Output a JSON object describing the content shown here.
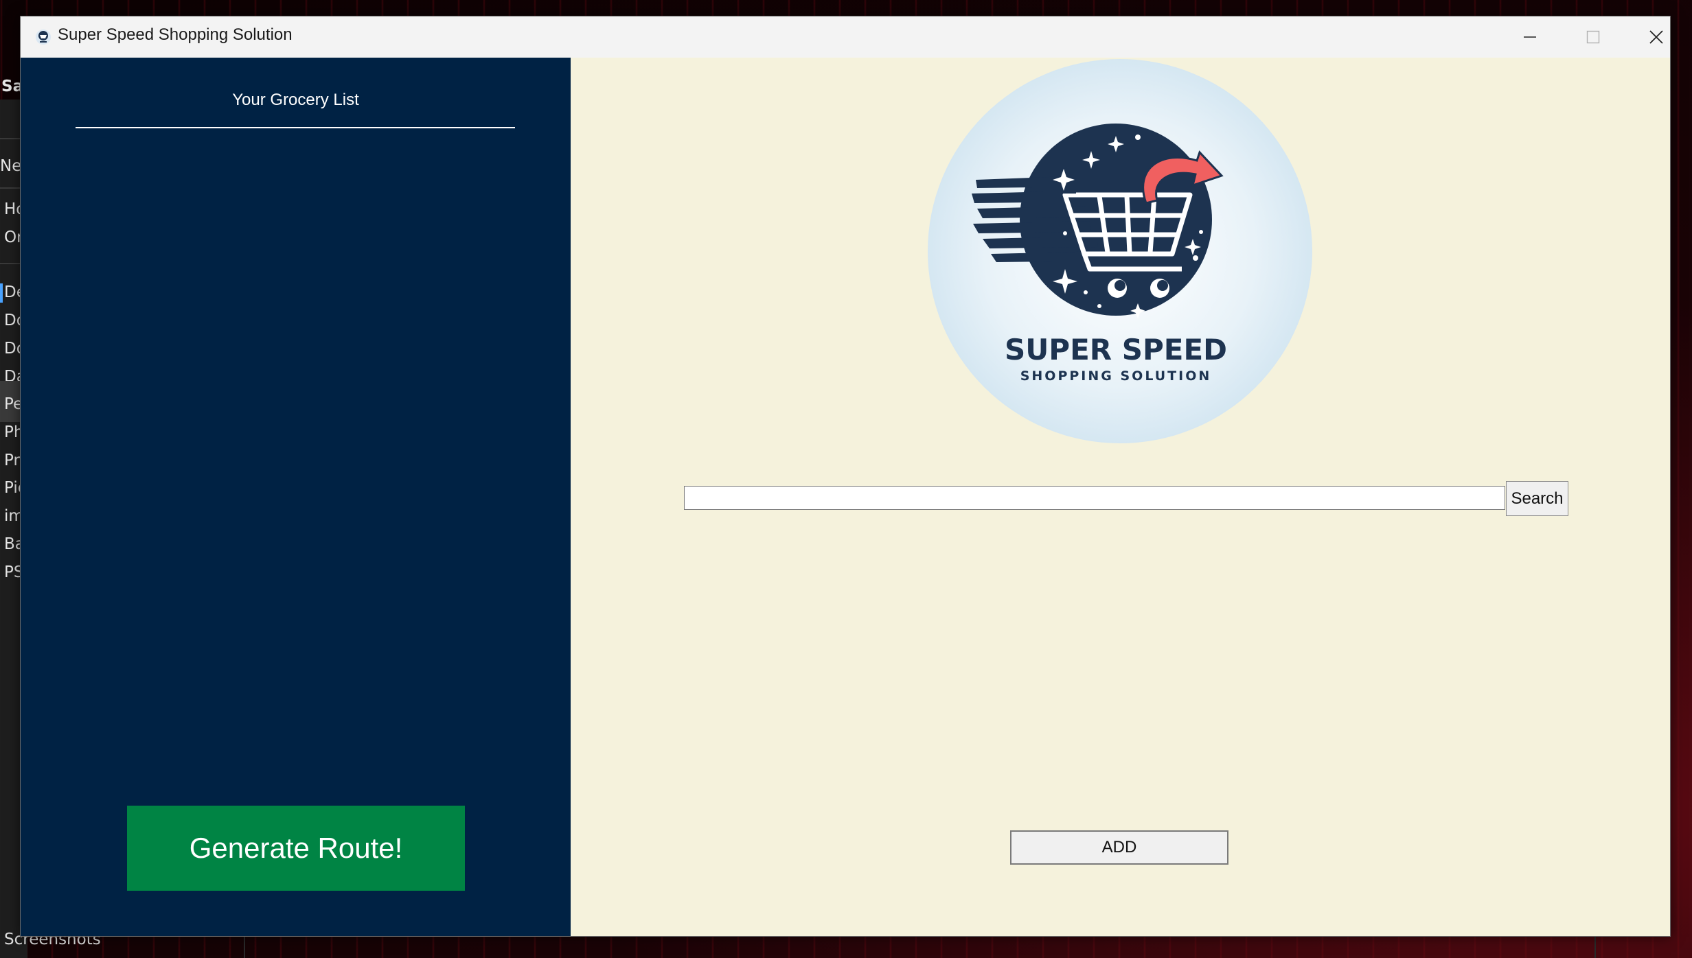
{
  "window": {
    "title": "Super Speed Shopping Solution",
    "controls": [
      "minimize",
      "maximize",
      "close"
    ]
  },
  "background_explorer": {
    "items": [
      "Sa",
      "Nev",
      "Ho",
      "On",
      "De",
      "Do",
      "Do",
      "Da",
      "Pe",
      "Ph",
      "Pr",
      "Pic",
      "im",
      "Ba",
      "PS"
    ],
    "footer": "Screenshots"
  },
  "left_panel": {
    "header": "Your Grocery List",
    "items": [],
    "generate_button_label": "Generate Route!",
    "background_color": "#002244",
    "button_color": "#008444"
  },
  "right_panel": {
    "logo": {
      "title": "SUPER SPEED",
      "subtitle": "SHOPPING SOLUTION",
      "icon": "shopping-cart-icon"
    },
    "search": {
      "value": "",
      "button_label": "Search"
    },
    "add_button_label": "ADD",
    "background_color": "#f5f2dc"
  }
}
